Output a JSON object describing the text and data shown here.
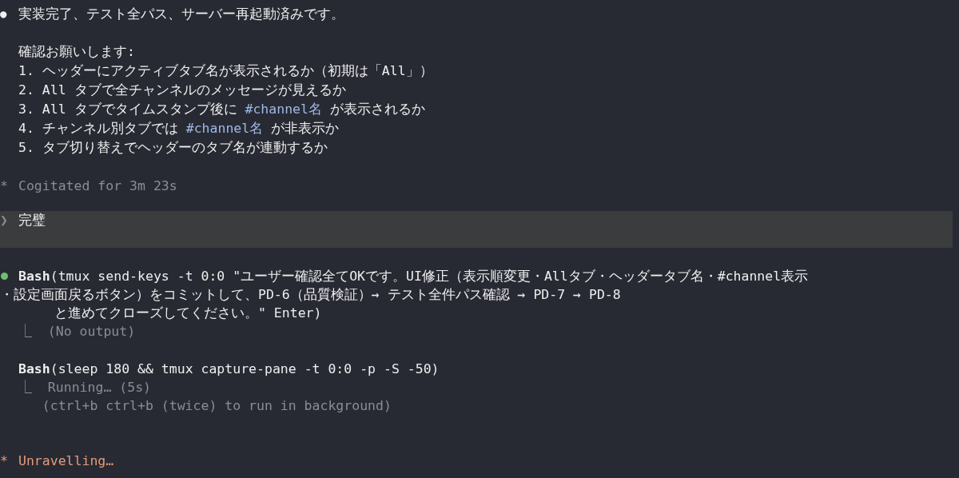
{
  "message": {
    "bullet": "●",
    "text": "実装完了、テスト全パス、サーバー再起動済みです。",
    "intro": "確認お願いします:",
    "items": [
      [
        {
          "kind": "text",
          "text": "1. ヘッダーにアクティブタブ名が表示されるか（初期は「All」）"
        }
      ],
      [
        {
          "kind": "text",
          "text": "2. All タブで全チャンネルのメッセージが見えるか"
        }
      ],
      [
        {
          "kind": "text",
          "text": "3. All タブでタイムスタンプ後に "
        },
        {
          "kind": "code",
          "text": "#channel名"
        },
        {
          "kind": "text",
          "text": " が表示されるか"
        }
      ],
      [
        {
          "kind": "text",
          "text": "4. チャンネル別タブでは "
        },
        {
          "kind": "code",
          "text": "#channel名"
        },
        {
          "kind": "text",
          "text": " が非表示か"
        }
      ],
      [
        {
          "kind": "text",
          "text": "5. タブ切り替えでヘッダーのタブ名が連動するか"
        }
      ]
    ]
  },
  "thinking": {
    "symbol": "*",
    "text": "Cogitated for 3m 23s"
  },
  "prompt": {
    "symbol": "❯",
    "text": "完璧"
  },
  "tool_calls": [
    {
      "done": true,
      "name": "Bash",
      "args_lines": [
        "(tmux send-keys -t 0:0 \"ユーザー確認全てOKです。UI修正（表示順変更・Allタブ・ヘッダータブ名・#channel表示",
        "・設定画面戻るボタン）をコミットして、PD-6（品質検証）→ テスト全件パス確認 → PD-7 → PD-8",
        "と進めてクローズしてください。\" Enter)"
      ],
      "output": [
        "⎿  (No output)"
      ]
    },
    {
      "done": false,
      "name": "Bash",
      "args_lines": [
        "(sleep 180 && tmux capture-pane -t 0:0 -p -S -50)"
      ],
      "output": [
        "⎿  Running… (5s)",
        "   (ctrl+b ctrl+b (twice) to run in background)"
      ]
    }
  ],
  "spinner": {
    "symbol": "*",
    "text": "Unravelling…"
  }
}
